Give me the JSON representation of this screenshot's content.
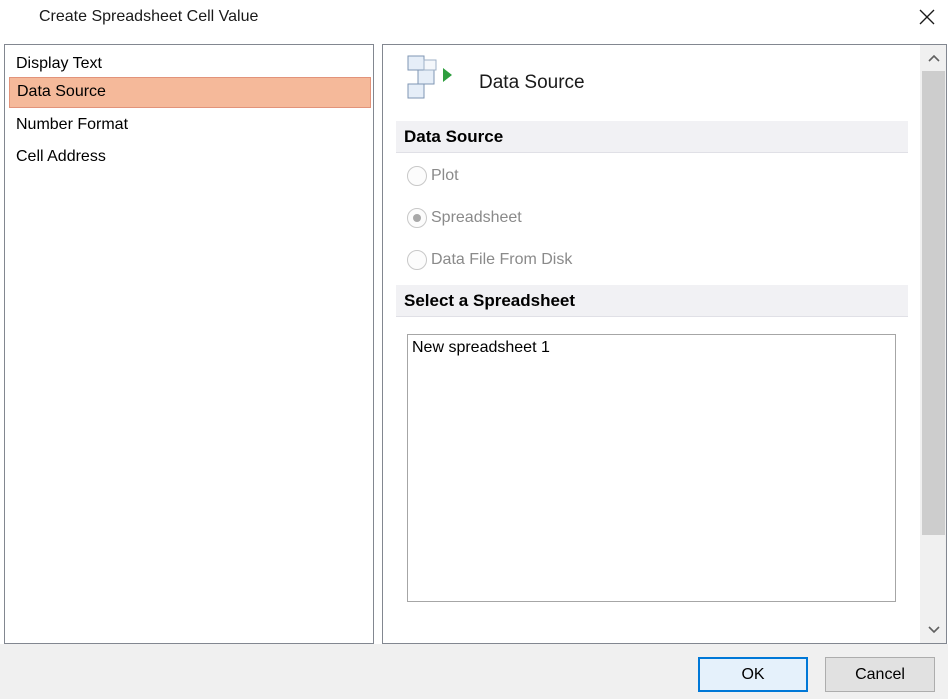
{
  "window": {
    "title": "Create Spreadsheet Cell Value",
    "close_icon": "close-icon"
  },
  "sidebar": {
    "items": [
      {
        "label": "Display Text",
        "selected": false
      },
      {
        "label": "Data Source",
        "selected": true
      },
      {
        "label": "Number Format",
        "selected": false
      },
      {
        "label": "Cell Address",
        "selected": false
      }
    ],
    "selected_color": "#f5b99a"
  },
  "page": {
    "icon": "data-source-icon",
    "heading": "Data Source",
    "data_source_section": {
      "title": "Data Source",
      "options": [
        {
          "label": "Plot",
          "checked": false,
          "enabled": false
        },
        {
          "label": "Spreadsheet",
          "checked": true,
          "enabled": false
        },
        {
          "label": "Data File From Disk",
          "checked": false,
          "enabled": false
        }
      ]
    },
    "spreadsheet_section": {
      "title": "Select a Spreadsheet",
      "items": [
        "New spreadsheet 1"
      ]
    }
  },
  "buttons": {
    "ok_label": "OK",
    "cancel_label": "Cancel"
  }
}
